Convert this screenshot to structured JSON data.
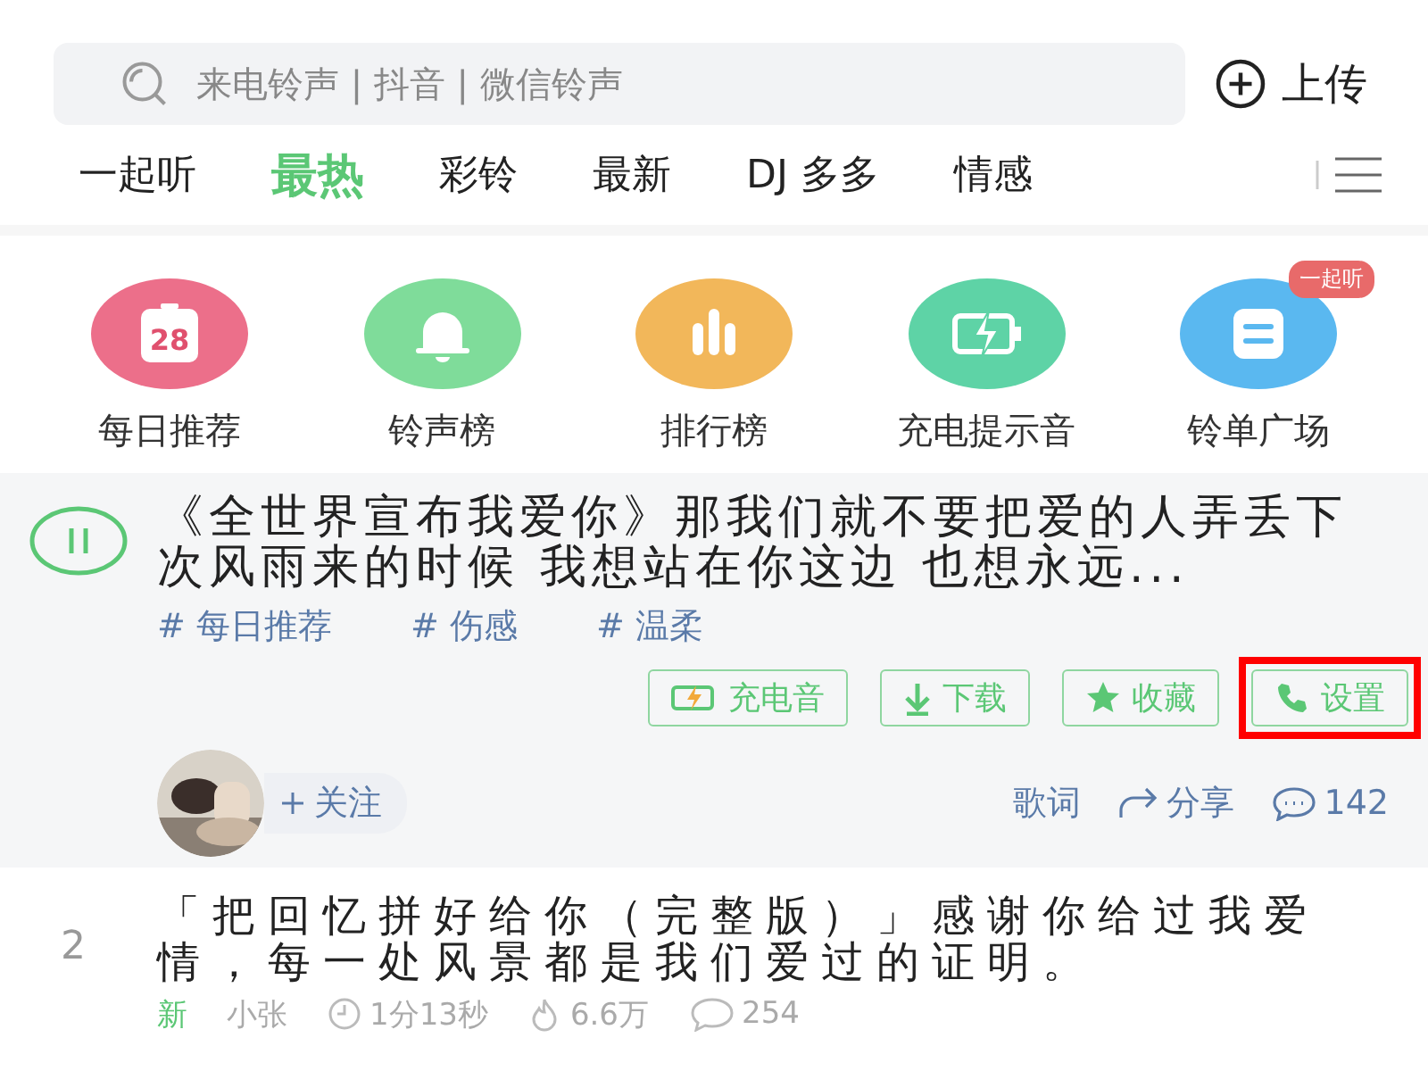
{
  "search": {
    "placeholder": "来电铃声 | 抖音 | 微信铃声"
  },
  "upload_button": "上传",
  "tabs": [
    {
      "label": "一起听",
      "selected": false
    },
    {
      "label": "最热",
      "selected": true
    },
    {
      "label": "彩铃",
      "selected": false
    },
    {
      "label": "最新",
      "selected": false
    },
    {
      "label": "DJ 多多",
      "selected": false
    },
    {
      "label": "情感",
      "selected": false
    }
  ],
  "shortcuts": [
    {
      "label": "每日推荐",
      "kind": "calendar",
      "color": "#ec6f8a",
      "icon_text": "28"
    },
    {
      "label": "铃声榜",
      "kind": "bell",
      "color": "#7fdc9a"
    },
    {
      "label": "排行榜",
      "kind": "chart",
      "color": "#f2b75a"
    },
    {
      "label": "充电提示音",
      "kind": "battery",
      "color": "#5ed3a6"
    },
    {
      "label": "铃单广场",
      "kind": "list",
      "color": "#5ab8f0",
      "badge": "一起听"
    }
  ],
  "songs": [
    {
      "playing": true,
      "title": "《全世界宣布我爱你》那我们就不要把爱的人弄丢下次风雨来的时候 我想站在你这边 也想永远...",
      "tags": [
        "# 每日推荐",
        "# 伤感",
        "# 温柔"
      ],
      "actions": [
        {
          "label": "充电音",
          "kind": "charge",
          "highlighted": false
        },
        {
          "label": "下载",
          "kind": "download",
          "highlighted": false
        },
        {
          "label": "收藏",
          "kind": "star",
          "highlighted": false
        },
        {
          "label": "设置",
          "kind": "phone",
          "highlighted": true
        }
      ],
      "follow": "关注",
      "lyrics": "歌词",
      "share": "分享",
      "comments": "142"
    },
    {
      "playing": false,
      "rank": "2",
      "title": "「把回忆拼好给你（完整版）」感谢你给过我爱情，每一处风景都是我们爱过的证明。",
      "is_new": true,
      "new_label": "新",
      "author": "小张",
      "duration": "1分13秒",
      "plays": "6.6万",
      "comments": "254"
    }
  ]
}
